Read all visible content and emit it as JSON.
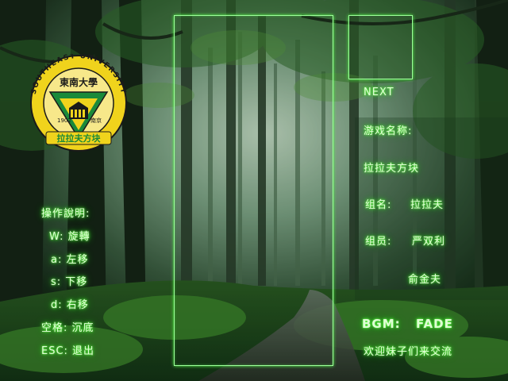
{
  "controls": {
    "title": "操作說明:",
    "rotate": "W: 旋轉",
    "left": "a: 左移",
    "down": "s: 下移",
    "right": "d: 右移",
    "drop": "空格: 沉底",
    "exit": "ESC: 退出"
  },
  "next_label": "NEXT",
  "info": {
    "game_name_label": "游戏名称:",
    "game_name": "拉拉夫方块",
    "group_label": "组名:",
    "group_name": "拉拉夫",
    "members_label": "组员:",
    "member_1": "严双利",
    "member_2": "俞金夫"
  },
  "bgm": {
    "label": "BGM:",
    "track": "FADE"
  },
  "footer_text": "欢迎妹子们来交流",
  "logo": {
    "university_name": "SOUTHEAST UNIVERSITY",
    "chinese_name": "東南大學",
    "year": "1902",
    "city": "南京",
    "banner": "拉拉夫方块"
  },
  "colors": {
    "glow": "#3ae22a",
    "frame": "#9dff9a",
    "logo_gold": "#f0d31c",
    "logo_green": "#1a8a3a"
  }
}
